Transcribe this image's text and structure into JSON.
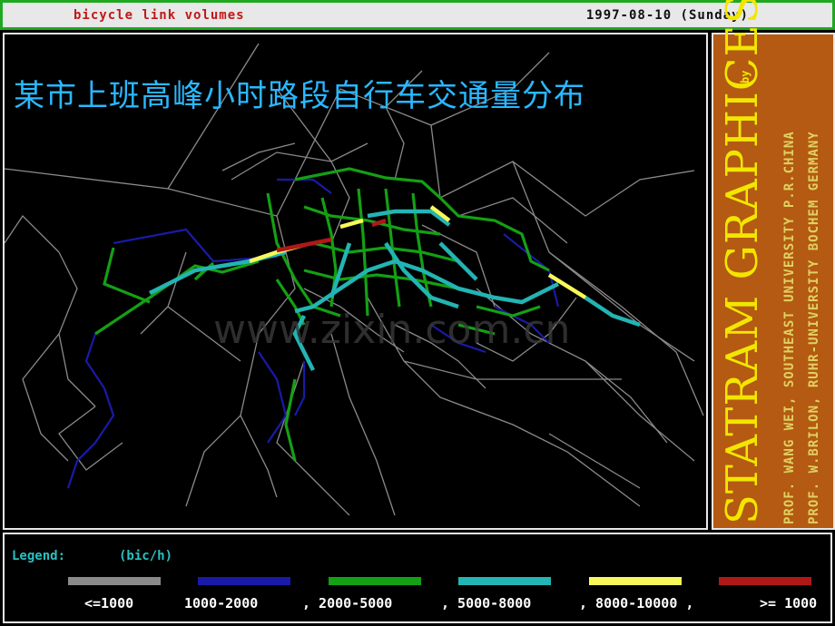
{
  "titlebar": {
    "left_text": "bicycle link volumes",
    "right_text": "1997-08-10 (Sunday)"
  },
  "map": {
    "title": "某市上班高峰小时路段自行车交通量分布",
    "watermark": "www.zixin.com.cn",
    "colors": {
      "gray": "#8a8a8a",
      "blue": "#1a1aa8",
      "green": "#14a014",
      "cyan": "#23b4b4",
      "yellow": "#f8f85a",
      "red": "#b01818"
    }
  },
  "side_panel": {
    "main_title": "STATRAM GRAPHICES",
    "by_text": "by",
    "credit_line1": "PROF. WANG WEI, SOUTHEAST UNIVERSITY P.R.CHINA",
    "credit_line2": "PROF. W.BRILON, RUHR-UNIVERSITY BOCHEM GERMANY"
  },
  "legend": {
    "label": "Legend:",
    "unit": "(bic/h)",
    "items": [
      {
        "text": "<=1000",
        "color": "#8a8a8a"
      },
      {
        "text": "1000-2000",
        "color": "#1a1aa8"
      },
      {
        "text": ", 2000-5000",
        "color": "#14a014"
      },
      {
        "text": ", 5000-8000",
        "color": "#23b4b4"
      },
      {
        "text": ", 8000-10000 ,",
        "color": "#f8f85a"
      },
      {
        "text": ">= 1000",
        "color": "#b01818"
      }
    ]
  }
}
